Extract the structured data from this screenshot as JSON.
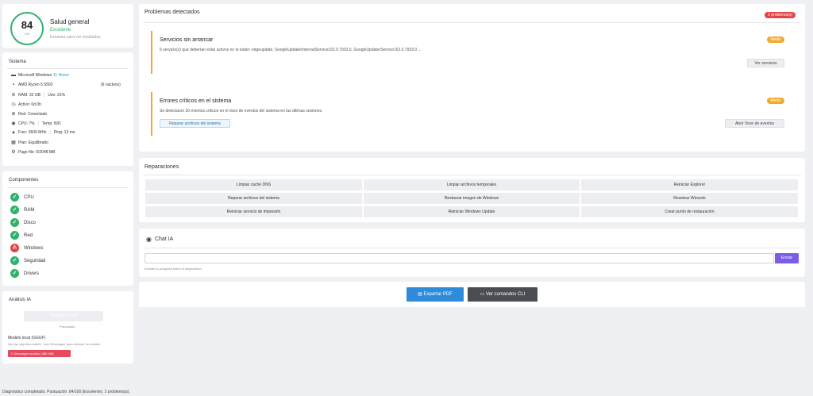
{
  "score": {
    "value": "84",
    "max": "100",
    "title": "Salud general",
    "status": "Excelente",
    "hint": "Escanea para ver resultados"
  },
  "system": {
    "title": "Sistema",
    "os": "Microsoft Windows",
    "os_version": "11 Home",
    "cpu_model": "AMD Ryzen 5 5500",
    "cores": "(6 núcleos)",
    "ram": "RAM: 32 GB",
    "ram_usage": "Uso: 31%",
    "uptime": "Activo: 0d 0h",
    "network": "Red: Conectado",
    "cpu_usage": "CPU: 7%",
    "temp": "Temp: N/D",
    "freq": "Frec: 3600 MHz",
    "ping": "Ping: 13 ms",
    "plan": "Plan: Equilibrado",
    "pagefile": "Page file: 0/2048 MB"
  },
  "components": {
    "title": "Componentes",
    "items": [
      {
        "label": "CPU",
        "status": "ok"
      },
      {
        "label": "RAM",
        "status": "ok"
      },
      {
        "label": "Disco",
        "status": "ok"
      },
      {
        "label": "Red",
        "status": "ok"
      },
      {
        "label": "Windows",
        "status": "warn"
      },
      {
        "label": "Seguridad",
        "status": "ok"
      },
      {
        "label": "Drivers",
        "status": "ok"
      }
    ]
  },
  "ai": {
    "title": "Análisis IA",
    "button_label": "Analizar con IA",
    "processed_label": "Procesado",
    "model_title": "Modelo local (GGUF)",
    "model_hint": "No hay carpeta models/. Usa 'Descargar' para obtener un modelo.",
    "download_label": "⇩ Descargar modelo (380 MB)"
  },
  "problems": {
    "title": "Problemas detectados",
    "count_badge": "2 problema(s)",
    "items": [
      {
        "title": "Servicios sin arrancar",
        "severity": "Medio",
        "description": "6 servicio(s) que deberían estar activos no lo están: edgeupdate, GoogleUpdaterInternalService152.0.7933.0, GoogleUpdaterService152.0.7933.0 ...",
        "action": "Ver servicios"
      },
      {
        "title": "Errores críticos en el sistema",
        "severity": "Medio",
        "description": "Se detectaron 30 eventos críticos en el visor de eventos del sistema en las últimas sesiones.",
        "action_primary": "Reparar archivos del sistema",
        "action": "Abrir Visor de eventos"
      }
    ]
  },
  "repairs": {
    "title": "Reparaciones",
    "buttons": [
      "Limpiar caché DNS",
      "Limpiar archivos temporales",
      "Reiniciar Explorer",
      "Reparar archivos del sistema",
      "Restaurar imagen de Windows",
      "Resetear Winsock",
      "Reiniciar servicio de impresión",
      "Reiniciar Windows Update",
      "Crear punto de restauración"
    ]
  },
  "chat": {
    "title": "Chat IA",
    "input_value": "",
    "send_label": "Enviar",
    "hint": "Escribe tu pregunta sobre el diagnóstico..."
  },
  "actions": {
    "pdf_label": "Exportar PDF",
    "cli_label": "Ver comandos CLI"
  },
  "status_bar": "Diagnóstico completado. Puntuación: 84/100 (Excelente). 2 problema(s)."
}
